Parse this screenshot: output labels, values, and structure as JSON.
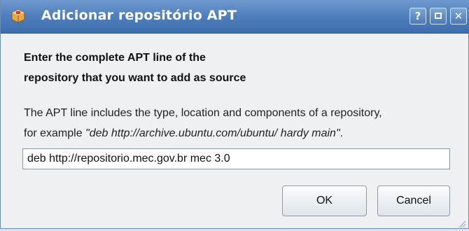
{
  "window": {
    "title": "Adicionar repositório APT",
    "help_label": "?",
    "close_label": "✕"
  },
  "dialog": {
    "heading_line1": "Enter the complete APT line of the",
    "heading_line2": "repository that you want to add as source",
    "desc_line1": "The APT line includes the type, location and components of a repository,",
    "desc_line2_prefix": "for example ",
    "desc_line2_example": "\"deb http://archive.ubuntu.com/ubuntu/ hardy main\"",
    "desc_line2_suffix": ".",
    "apt_line_value": "deb http://repositorio.mec.gov.br mec 3.0"
  },
  "buttons": {
    "ok_label": "OK",
    "cancel_label": "Cancel"
  },
  "colors": {
    "titlebar": "#4f7ebd",
    "window_bg": "#eef0f2"
  },
  "icons": {
    "app": "package-icon",
    "help": "help-icon",
    "maximize": "maximize-icon",
    "close": "close-icon"
  }
}
